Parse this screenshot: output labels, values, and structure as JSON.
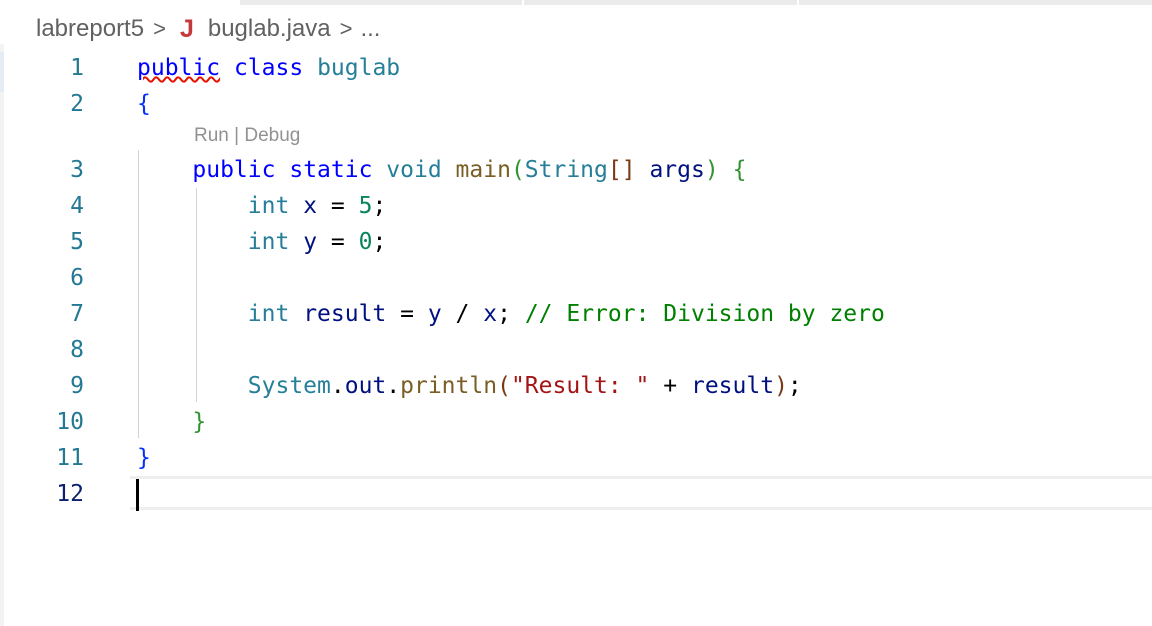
{
  "breadcrumb": {
    "folder": "labreport5",
    "separator": ">",
    "file_icon": "java-icon",
    "file_icon_glyph": "J",
    "file": "buglab.java",
    "ellipsis": "..."
  },
  "codelens": "Run | Debug",
  "lines": [
    {
      "n": "1"
    },
    {
      "n": "2"
    },
    {
      "n": "3"
    },
    {
      "n": "4"
    },
    {
      "n": "5"
    },
    {
      "n": "6"
    },
    {
      "n": "7"
    },
    {
      "n": "8"
    },
    {
      "n": "9"
    },
    {
      "n": "10"
    },
    {
      "n": "11"
    },
    {
      "n": "12"
    }
  ],
  "tokens": {
    "l1": {
      "public": "public",
      "class": "class",
      "name": "buglab"
    },
    "l2": {
      "open": "{"
    },
    "l3": {
      "public": "public",
      "static": "static",
      "void": "void",
      "main": "main",
      "paren_open": "(",
      "String": "String",
      "arr": "[]",
      "args": "args",
      "paren_close": ")",
      "brace": "{"
    },
    "l4": {
      "int": "int",
      "x": "x",
      "eq": " = ",
      "val": "5",
      "semi": ";"
    },
    "l5": {
      "int": "int",
      "y": "y",
      "eq": " = ",
      "val": "0",
      "semi": ";"
    },
    "l7": {
      "int": "int",
      "result": "result",
      "eq": " = ",
      "y": "y",
      "div": " / ",
      "x": "x",
      "semi": ";",
      "comment": "// Error: Division by zero"
    },
    "l9": {
      "System": "System",
      "dot1": ".",
      "out": "out",
      "dot2": ".",
      "println": "println",
      "paren_open": "(",
      "str": "\"Result: \"",
      "plus": " + ",
      "result": "result",
      "paren_close": ")",
      "semi": ";"
    },
    "l10": {
      "close": "}"
    },
    "l11": {
      "close": "}"
    }
  },
  "colors": {
    "keyword": "#0000ff",
    "type": "#267f99",
    "function": "#795e26",
    "variable": "#001080",
    "number": "#098658",
    "string": "#a31515",
    "comment": "#008000",
    "line_number": "#237893",
    "java_icon": "#c5383b"
  }
}
